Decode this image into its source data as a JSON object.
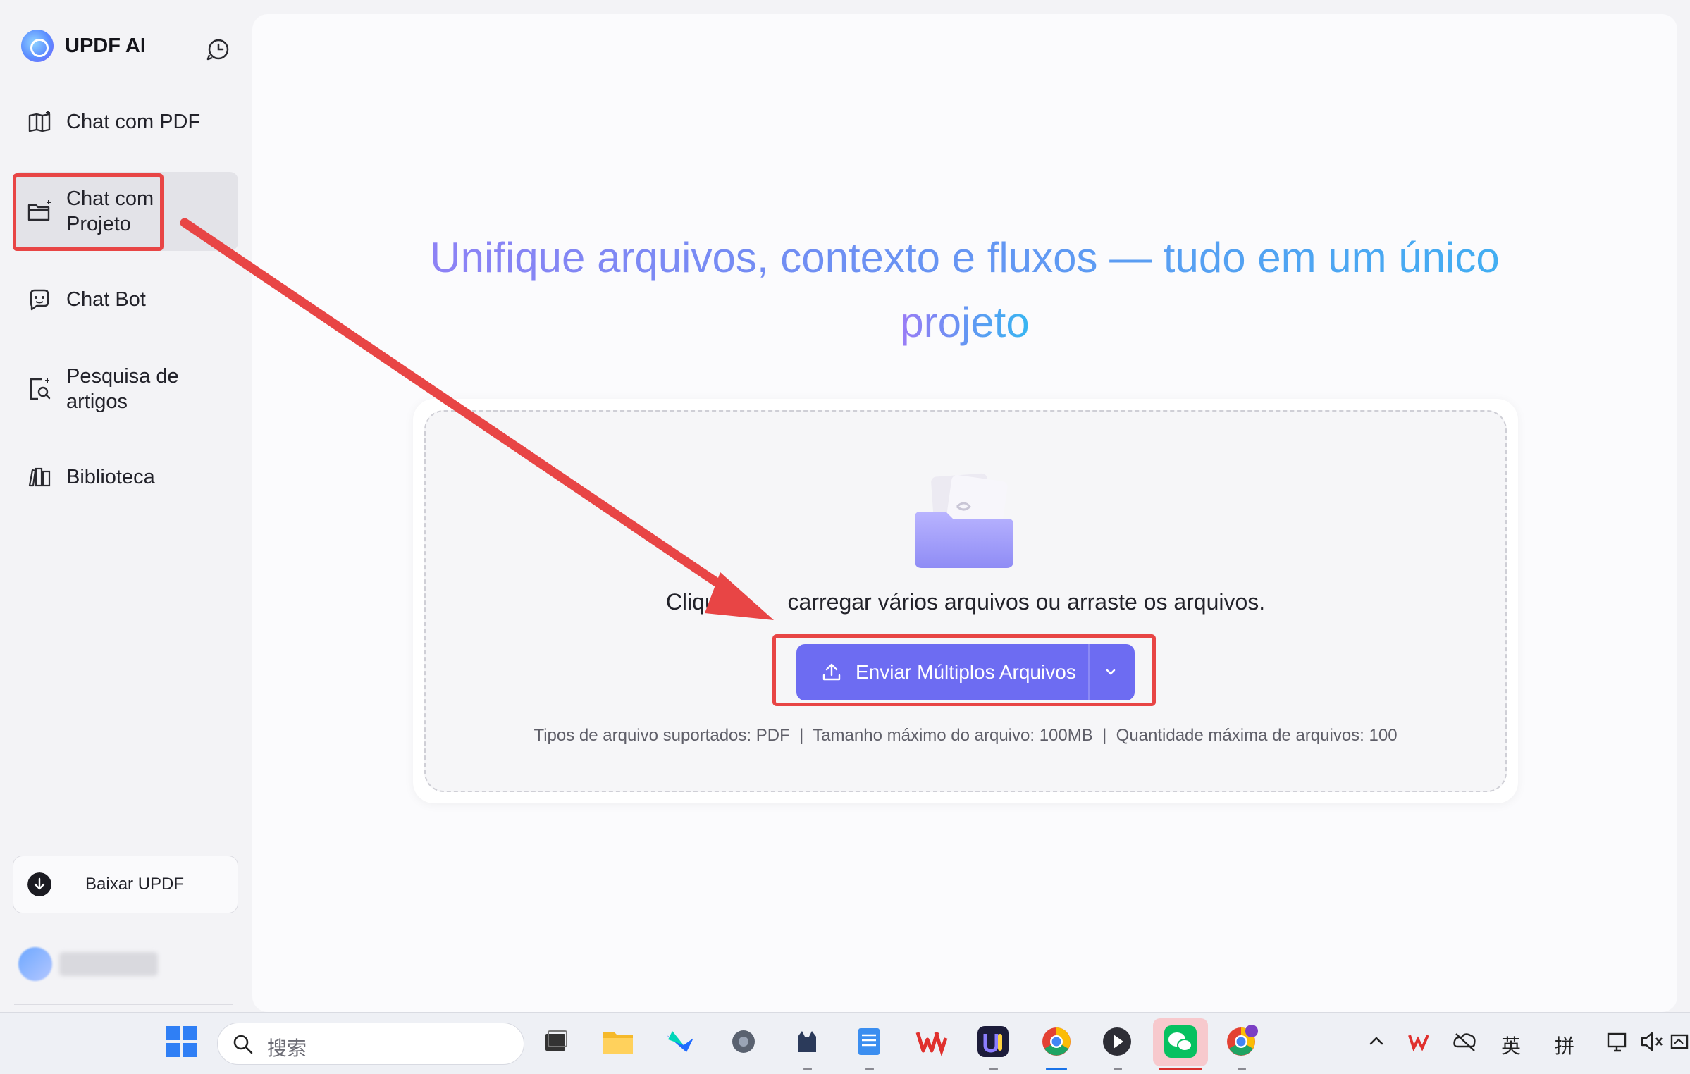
{
  "brand": {
    "name": "UPDF AI"
  },
  "sidebar": {
    "items": [
      {
        "label": "Chat com PDF",
        "icon": "book-sparkle-icon"
      },
      {
        "label": "Chat com\nProjeto",
        "line1": "Chat com",
        "line2": "Projeto",
        "icon": "folder-sparkle-icon",
        "active": true
      },
      {
        "label": "Chat Bot",
        "icon": "bot-icon"
      },
      {
        "label": "Pesquisa de artigos",
        "line1": "Pesquisa de",
        "line2": "artigos",
        "icon": "doc-search-icon"
      },
      {
        "label": "Biblioteca",
        "icon": "library-icon"
      }
    ],
    "download_label": "Baixar UPDF"
  },
  "main": {
    "headline_line1": "Unifique arquivos, contexto e fluxos — tudo em um único",
    "headline_line2": "projeto",
    "drop_text": "Clique para carregar vários arquivos ou arraste os arquivos.",
    "drop_text_visible_left": "Clique",
    "drop_text_visible_right": "carregar vários arquivos ou arraste os arquivos.",
    "upload_button_label": "Enviar Múltiplos Arquivos",
    "file_info": "Tipos de arquivo suportados: PDF  |  Tamanho máximo do arquivo: 100MB  |  Quantidade máxima de arquivos: 100"
  },
  "colors": {
    "accent": "#6d6cf2",
    "annotation": "#e84545",
    "gradient_start": "#9b7cf6",
    "gradient_end": "#36b6f2"
  },
  "taskbar": {
    "search_placeholder": "搜索",
    "tray_lang1": "英",
    "tray_lang2": "拼"
  }
}
